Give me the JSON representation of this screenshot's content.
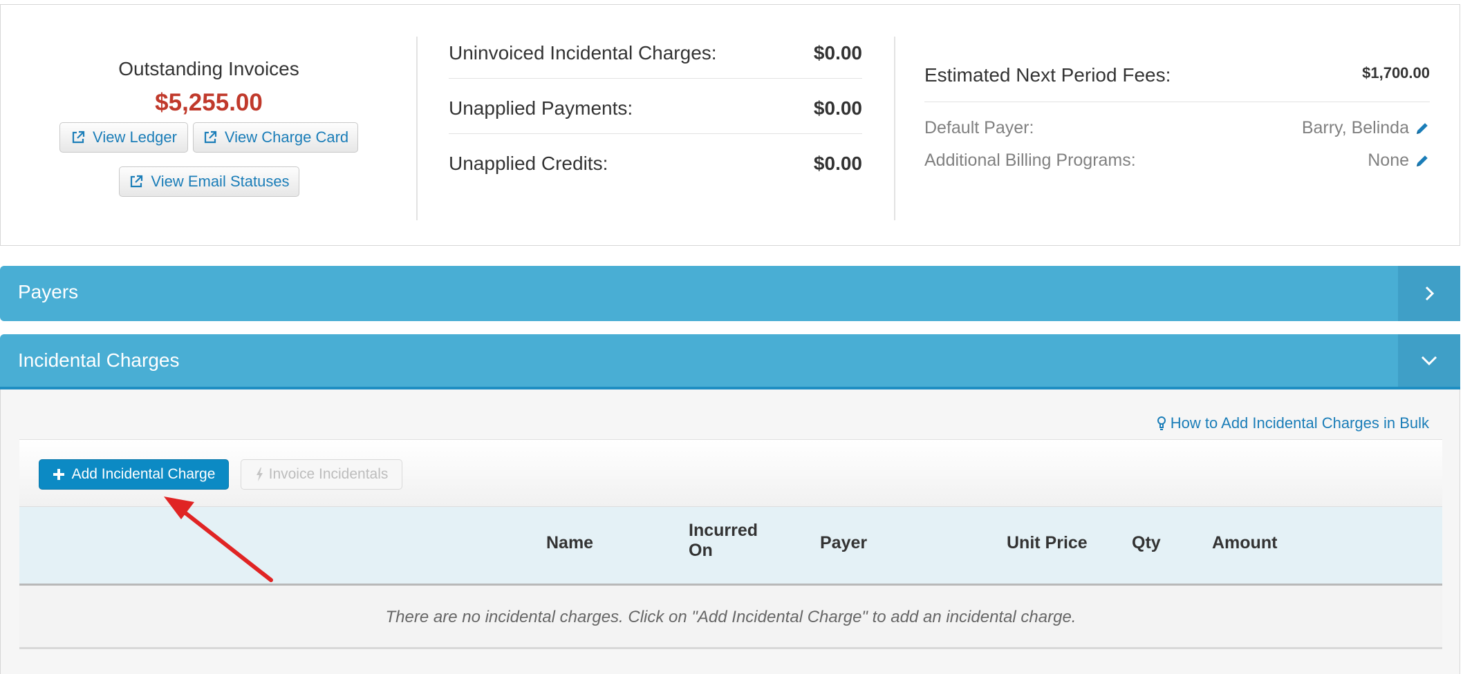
{
  "summary": {
    "outstanding_invoices": {
      "title": "Outstanding Invoices",
      "amount": "$5,255.00",
      "amount_color": "#c0392b"
    },
    "buttons": {
      "view_ledger": "View Ledger",
      "view_charge_card": "View Charge Card",
      "view_email_statuses": "View Email Statuses"
    },
    "balances": [
      {
        "label": "Uninvoiced Incidental Charges:",
        "value": "$0.00"
      },
      {
        "label": "Unapplied Payments:",
        "value": "$0.00"
      },
      {
        "label": "Unapplied Credits:",
        "value": "$0.00"
      }
    ],
    "estimated_next_period_fees": {
      "label": "Estimated Next Period Fees:",
      "value": "$1,700.00"
    },
    "default_payer": {
      "label": "Default Payer:",
      "value": "Barry, Belinda"
    },
    "additional_billing_programs": {
      "label": "Additional Billing Programs:",
      "value": "None"
    }
  },
  "sections": {
    "payers": {
      "title": "Payers",
      "state": "collapsed"
    },
    "incidental": {
      "title": "Incidental Charges",
      "state": "expanded"
    }
  },
  "incidental": {
    "bulk_link": "How to Add Incidental Charges in Bulk",
    "add_button": "Add Incidental Charge",
    "invoice_button": "Invoice Incidentals",
    "columns": {
      "name": "Name",
      "incurred_line1": "Incurred",
      "incurred_line2": "On",
      "payer": "Payer",
      "unit_price": "Unit Price",
      "qty": "Qty",
      "amount": "Amount"
    },
    "empty_message": "There are no incidental charges. Click on \"Add Incidental Charge\" to add an incidental charge."
  },
  "colors": {
    "accent": "#49aed4",
    "primary_button": "#0c8ac4",
    "link": "#1a7db8",
    "annotation_arrow": "#e02424"
  },
  "icons": [
    "external-link-icon",
    "pencil-icon",
    "chevron-right-icon",
    "chevron-down-icon",
    "lightbulb-icon",
    "plus-icon",
    "bolt-icon"
  ]
}
